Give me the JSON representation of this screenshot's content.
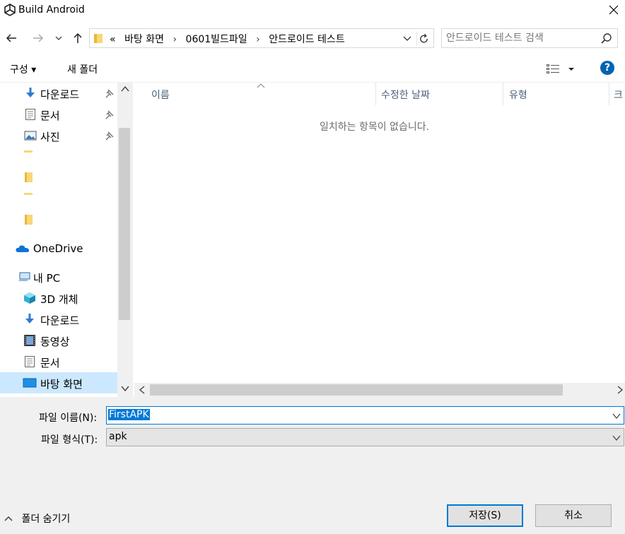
{
  "window": {
    "title": "Build Android"
  },
  "address": {
    "crumb_prefix": "«",
    "crumbs": [
      "바탕 화면",
      "0601빌드파일",
      "안드로이드 테스트"
    ],
    "separator": "›"
  },
  "search": {
    "placeholder": "안드로이드 테스트 검색"
  },
  "toolbar": {
    "organize_label": "구성 ▾",
    "new_folder_label": "새 폴더",
    "help_label": "?"
  },
  "nav": {
    "quick_access": [
      {
        "label": "다운로드",
        "icon": "download-icon",
        "pinned": true
      },
      {
        "label": "문서",
        "icon": "document-icon",
        "pinned": true
      },
      {
        "label": "사진",
        "icon": "pictures-icon",
        "pinned": true
      }
    ],
    "onedrive": {
      "label": "OneDrive",
      "icon": "cloud-icon"
    },
    "this_pc": {
      "label": "내 PC",
      "icon": "computer-icon"
    },
    "pc_items": [
      {
        "label": "3D 개체",
        "icon": "cube-icon"
      },
      {
        "label": "다운로드",
        "icon": "download-icon"
      },
      {
        "label": "동영상",
        "icon": "video-icon"
      },
      {
        "label": "문서",
        "icon": "document-icon"
      },
      {
        "label": "바탕 화면",
        "icon": "desktop-icon",
        "selected": true
      }
    ]
  },
  "files": {
    "columns": [
      "이름",
      "수정한 날짜",
      "유형",
      "크"
    ],
    "empty_message": "일치하는 항목이 없습니다."
  },
  "form": {
    "filename_label": "파일 이름(N):",
    "filename_value": "FirstAPK",
    "filetype_label": "파일 형식(T):",
    "filetype_value": "apk"
  },
  "footer": {
    "hide_folders_label": "폴더 숨기기",
    "save_label": "저장(S)",
    "cancel_label": "취소"
  },
  "colors": {
    "accent": "#0078d7",
    "selected_bg": "#cce8ff",
    "help_bg": "#0063b1"
  }
}
